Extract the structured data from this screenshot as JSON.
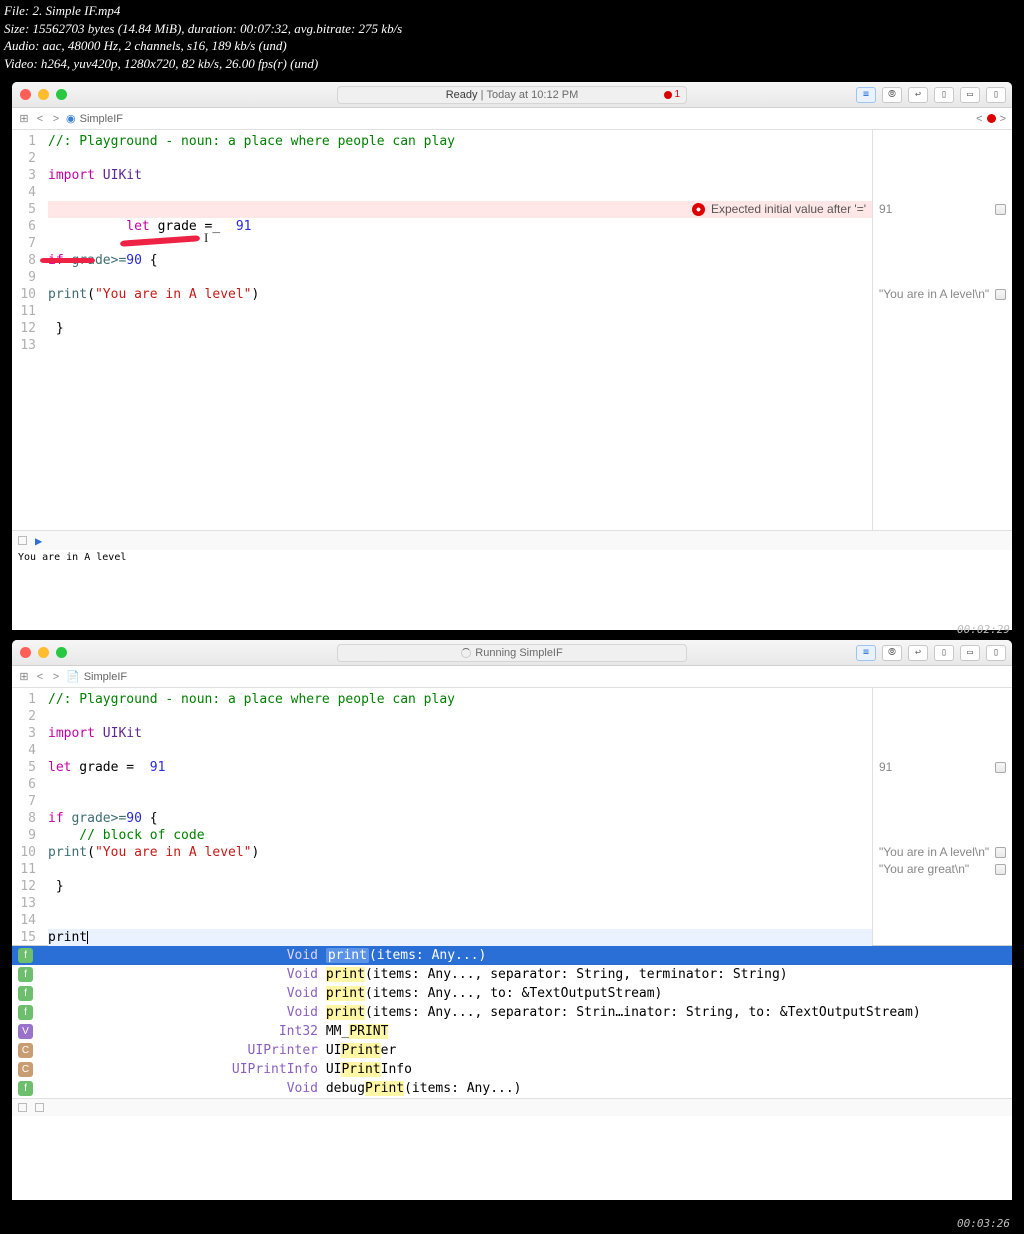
{
  "media": {
    "file": "File: 2. Simple IF.mp4",
    "size": "Size: 15562703 bytes (14.84 MiB), duration: 00:07:32, avg.bitrate: 275 kb/s",
    "audio": "Audio: aac, 48000 Hz, 2 channels, s16, 189 kb/s (und)",
    "video": "Video: h264, yuv420p, 1280x720, 82 kb/s, 26.00 fps(r) (und)"
  },
  "timestamps": {
    "t1": "00:02:29",
    "t2": "00:03:26"
  },
  "win1": {
    "status_left": "Ready",
    "status_right": "Today at 10:12 PM",
    "err_count": "1",
    "breadcrumb": "SimpleIF",
    "lines": {
      "l1": "//: Playground - noun: a place where people can play",
      "l3a": "import",
      "l3b": " UIKit",
      "l5a": "let",
      "l5b": " grade =_  ",
      "l5c": "91",
      "l8a": "if",
      "l8b": " grade>=",
      "l8c": "90",
      "l8d": " {",
      "l10a": "print",
      "l10b": "(",
      "l10s": "\"You are in A level\"",
      "l10c": ")",
      "l12": " }"
    },
    "error_msg": "Expected initial value after '='",
    "results": {
      "r5": "91",
      "r10": "\"You are in A level\\n\""
    },
    "console": "You are in A level"
  },
  "win2": {
    "status": "Running SimpleIF",
    "breadcrumb": "SimpleIF",
    "lines": {
      "l1": "//: Playground - noun: a place where people can play",
      "l3a": "import",
      "l3b": " UIKit",
      "l5a": "let",
      "l5b": " grade =  ",
      "l5c": "91",
      "l8a": "if",
      "l8b": " grade>=",
      "l8c": "90",
      "l8d": " {",
      "l9": "    // block of code",
      "l10a": "print",
      "l10b": "(",
      "l10s": "\"You are in A level\"",
      "l10c": ")",
      "l12": " }",
      "l15": "print"
    },
    "results": {
      "r5": "91",
      "r10": "\"You are in A level\\n\"",
      "r11": "\"You are great\\n\""
    },
    "ac": {
      "ret1": "Void",
      "sig1": "(items: Any...)",
      "ret2": "Void",
      "sig2": "(items: Any..., separator: String, terminator: String)",
      "ret3": "Void",
      "sig3": "(items: Any..., to: &TextOutputStream)",
      "ret4": "Void",
      "sig4": "(items: Any..., separator: Strin…inator: String, to: &TextOutputStream)",
      "ret5": "Int32",
      "name5": "MM_",
      "hl5": "PRINT",
      "ret6": "UIPrinter",
      "name6a": "UI",
      "hl6": "Print",
      "name6b": "er",
      "ret7": "UIPrintInfo",
      "name7a": "UI",
      "hl7": "Print",
      "name7b": "Info",
      "ret8": "Void",
      "name8a": "debug",
      "hl8": "Print",
      "sig8": "(items: Any...)",
      "print_label": "print"
    }
  }
}
